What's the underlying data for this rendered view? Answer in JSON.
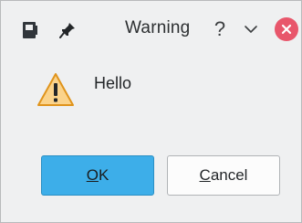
{
  "window": {
    "title": "Warning",
    "title_buttons": {
      "help_glyph": "?",
      "minimize_icon": "chevron-down-icon",
      "close_icon": "close-icon"
    },
    "left_icons": [
      "app-icon",
      "pin-icon"
    ]
  },
  "dialog": {
    "icon": "warning-icon",
    "message": "Hello",
    "buttons": {
      "ok": {
        "mnemonic": "O",
        "rest": "K"
      },
      "cancel": {
        "mnemonic": "C",
        "rest": "ancel"
      }
    }
  },
  "colors": {
    "ok_button": "#3daee9",
    "close_button": "#e8566b",
    "warning_icon_fill": "#fbd38b",
    "warning_icon_stroke": "#e0941c"
  }
}
